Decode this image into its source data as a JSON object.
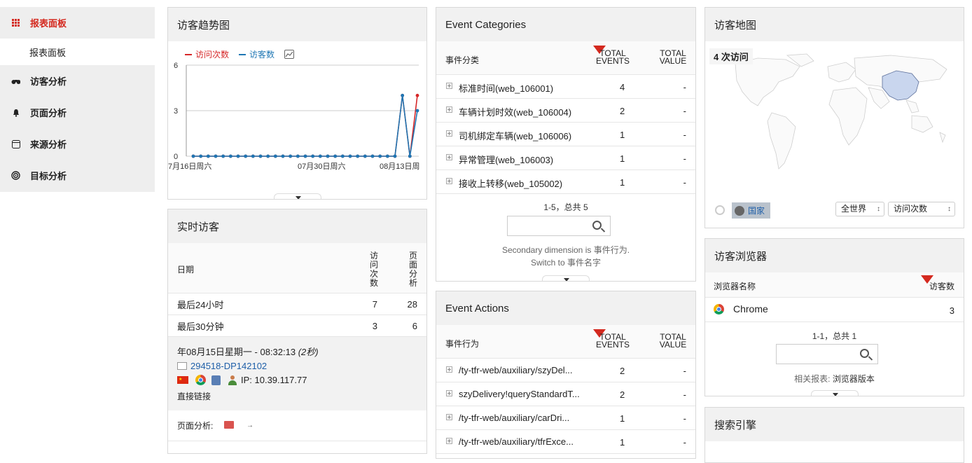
{
  "sidebar": {
    "items": [
      {
        "label": "报表面板",
        "icon": "grid-icon"
      },
      {
        "label": "报表面板"
      },
      {
        "label": "访客分析",
        "icon": "binoculars-icon"
      },
      {
        "label": "页面分析",
        "icon": "bell-icon"
      },
      {
        "label": "来源分析",
        "icon": "window-icon"
      },
      {
        "label": "目标分析",
        "icon": "target-icon"
      }
    ]
  },
  "trend": {
    "title": "访客趋势图",
    "legend_visits": "访问次数",
    "legend_visitors": "访客数",
    "xlabels": [
      "7月16日周六",
      "07月30日周六",
      "08月13日周"
    ]
  },
  "chart_data": {
    "type": "line",
    "yticks": [
      "6",
      "3",
      "0"
    ],
    "ylim": [
      0,
      6
    ],
    "series": [
      {
        "name": "访问次数",
        "color": "#d62728",
        "values": [
          0,
          0,
          0,
          0,
          0,
          0,
          0,
          0,
          0,
          0,
          0,
          0,
          0,
          0,
          0,
          0,
          0,
          0,
          0,
          0,
          0,
          0,
          0,
          0,
          0,
          0,
          0,
          0,
          4,
          0,
          4
        ]
      },
      {
        "name": "访客数",
        "color": "#1f77b4",
        "values": [
          0,
          0,
          0,
          0,
          0,
          0,
          0,
          0,
          0,
          0,
          0,
          0,
          0,
          0,
          0,
          0,
          0,
          0,
          0,
          0,
          0,
          0,
          0,
          0,
          0,
          0,
          0,
          0,
          4,
          0,
          3
        ]
      }
    ]
  },
  "realtime": {
    "title": "实时访客",
    "col_date": "日期",
    "col_visits": "访问次数",
    "col_pages": "页面分析",
    "rows": [
      {
        "label": "最后24小时",
        "visits": "7",
        "pages": "28"
      },
      {
        "label": "最后30分钟",
        "visits": "3",
        "pages": "6"
      }
    ],
    "visit_time": "年08月15日星期一 - 08:32:13",
    "visit_duration": "(2秒)",
    "visitor_id": "294518-DP142102",
    "ip": "IP: 10.39.117.77",
    "referrer": "直接链接",
    "pages_label": "页面分析:"
  },
  "categories": {
    "title": "Event Categories",
    "col_name": "事件分类",
    "col_events": "TOTAL EVENTS",
    "col_value": "TOTAL VALUE",
    "rows": [
      {
        "name": "标准时间(web_106001)",
        "events": "4",
        "value": "-"
      },
      {
        "name": "车辆计划时效(web_106004)",
        "events": "2",
        "value": "-"
      },
      {
        "name": "司机绑定车辆(web_106006)",
        "events": "1",
        "value": "-"
      },
      {
        "name": "异常管理(web_106003)",
        "events": "1",
        "value": "-"
      },
      {
        "name": "接收上转移(web_105002)",
        "events": "1",
        "value": "-"
      }
    ],
    "pager": "1-5，总共 5",
    "secondary": "Secondary dimension is 事件行为.",
    "switch": "Switch to 事件名字"
  },
  "actions": {
    "title": "Event Actions",
    "col_name": "事件行为",
    "col_events": "TOTAL EVENTS",
    "col_value": "TOTAL VALUE",
    "rows": [
      {
        "name": "/ty-tfr-web/auxiliary/szyDel...",
        "events": "2",
        "value": "-"
      },
      {
        "name": "szyDelivery!queryStandardT...",
        "events": "2",
        "value": "-"
      },
      {
        "name": "/ty-tfr-web/auxiliary/carDri...",
        "events": "1",
        "value": "-"
      },
      {
        "name": "/ty-tfr-web/auxiliary/tfrExce...",
        "events": "1",
        "value": "-"
      }
    ]
  },
  "map": {
    "title": "访客地图",
    "visits": "4 次访问",
    "country_btn": "国家",
    "region": "全世界",
    "metric": "访问次数"
  },
  "browser": {
    "title": "访客浏览器",
    "col_name": "浏览器名称",
    "col_visitors": "访客数",
    "rows": [
      {
        "name": "Chrome",
        "visitors": "3"
      }
    ],
    "pager": "1-1，总共 1",
    "related_label": "相关报表:",
    "related_link": "浏览器版本"
  },
  "search": {
    "title": "搜索引擎"
  }
}
